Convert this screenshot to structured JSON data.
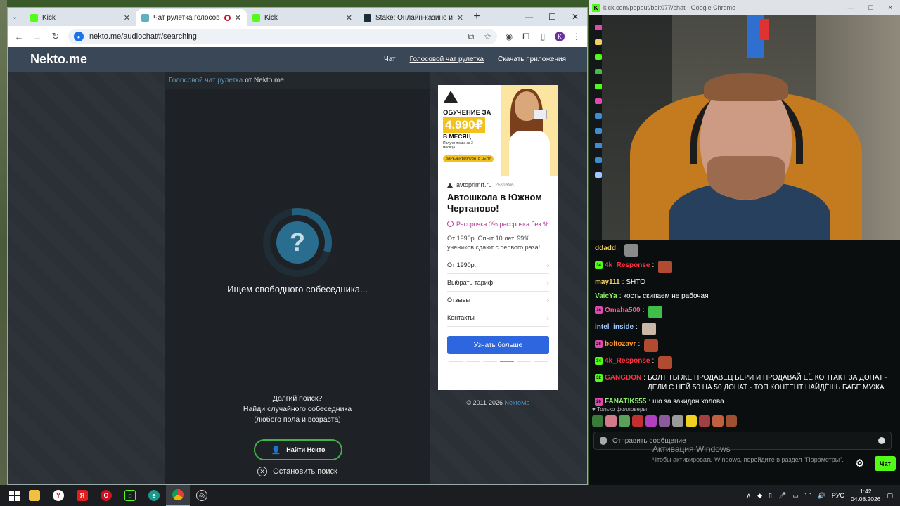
{
  "browser": {
    "tabs": [
      {
        "label": "Kick",
        "color": "#53fc18",
        "active": false
      },
      {
        "label": "Чат рулетка голосовая — ",
        "color": "#5fb0c0",
        "active": true,
        "recording": true
      },
      {
        "label": "Kick",
        "color": "#53fc18",
        "active": false
      },
      {
        "label": "Stake: Онлайн-казино и ставки",
        "color": "#1a2c38",
        "active": false
      }
    ],
    "address": "nekto.me/audiochat#/searching"
  },
  "site": {
    "logo": "Nekto.me",
    "nav": [
      "Чат",
      "Голосовой чат рулетка",
      "Скачать приложения"
    ],
    "crumb_link": "Голосовой чат рулетка",
    "crumb_rest": "от Nekto.me",
    "spinner_symbol": "?",
    "searching_text": "Ищем свободного собеседника...",
    "long_search_1": "Долгий поиск?",
    "long_search_2": "Найди случайного собеседника",
    "long_search_3": "(любого пола и возраста)",
    "find_button": "Найти Некто",
    "stop_search": "Остановить поиск",
    "copyright": "© 2011-2026",
    "copyright_link": "NektoMe"
  },
  "ad": {
    "banner_line1": "ОБУЧЕНИЕ ЗА",
    "banner_price": "4.990₽",
    "banner_line2": "В МЕСЯЦ",
    "banner_small": "Получи права за 3 месяца",
    "banner_button": "ЗАРЕЗЕРВИРОВАТЬ ЦЕНУ",
    "source": "avtoprimrf.ru",
    "source_tag": "РЕКЛАМА",
    "title": "Автошкола в Южном Чертаново!",
    "promo": "Рассрочка 0% рассрочка без %",
    "description": "От 1990р. Опыт 10 лет. 99% учеников сдают с первого раза!",
    "links": [
      "От 1990р.",
      "Выбрать тариф",
      "Отзывы",
      "Контакты"
    ],
    "cta": "Узнать больше"
  },
  "chat_window": {
    "url": "kick.com/popout/bolt077/chat - Google Chrome",
    "messages": [
      {
        "badge": "",
        "badge_color": "",
        "user": "ddadd",
        "user_color": "#f0d060",
        "text": "",
        "emote": "#8a8a8a"
      },
      {
        "badge": "34",
        "badge_color": "#53fc18",
        "user": "4k_Response",
        "user_color": "#ff3040",
        "text": "",
        "emote": "#b04a30"
      },
      {
        "badge": "",
        "badge_color": "",
        "user": "may111",
        "user_color": "#f0d060",
        "text": "SHTO",
        "emote": ""
      },
      {
        "badge": "",
        "badge_color": "",
        "user": "VaicYa",
        "user_color": "#8ef06a",
        "text": "кость скипаем не рабочая",
        "emote": ""
      },
      {
        "badge": "26",
        "badge_color": "#e04ab0",
        "user": "Omaha500",
        "user_color": "#ff5a9a",
        "text": "",
        "emote": "#3fbf4a"
      },
      {
        "badge": "",
        "badge_color": "",
        "user": "intel_inside",
        "user_color": "#9ec8ff",
        "text": "",
        "emote": "#c9b8a8"
      },
      {
        "badge": "26",
        "badge_color": "#e04ab0",
        "user": "boltozavr",
        "user_color": "#ff9a30",
        "text": "",
        "emote": "#b04a30"
      },
      {
        "badge": "34",
        "badge_color": "#53fc18",
        "user": "4k_Response",
        "user_color": "#ff3040",
        "text": "",
        "emote": "#b04a30"
      },
      {
        "badge": "32",
        "badge_color": "#53fc18",
        "user": "GANGDON",
        "user_color": "#ff3040",
        "text": "БОЛТ ТЫ ЖЕ ПРОДАВЕЦ БЕРИ И ПРОДАВАЙ ЕЁ КОНТАКТ ЗА ДОНАТ - ДЕЛИ С НЕЙ 50 НА 50 ДОНАТ - ТОП КОНТЕНТ НАЙДЁШЬ БАБЕ МУЖА",
        "emote": ""
      },
      {
        "badge": "26",
        "badge_color": "#e04ab0",
        "user": "FANATIK555",
        "user_color": "#8ef06a",
        "text": "шо за закидон холова",
        "emote": ""
      }
    ],
    "followers_only": "Только фолловеры",
    "input_placeholder": "Отправить сообщение",
    "chat_button": "Чат",
    "activation_title": "Активация Windows",
    "activation_text": "Чтобы активировать Windows, перейдите в раздел \"Параметры\"."
  },
  "taskbar": {
    "lang": "РУС",
    "time": "1:42",
    "date": "04.08.2026"
  }
}
